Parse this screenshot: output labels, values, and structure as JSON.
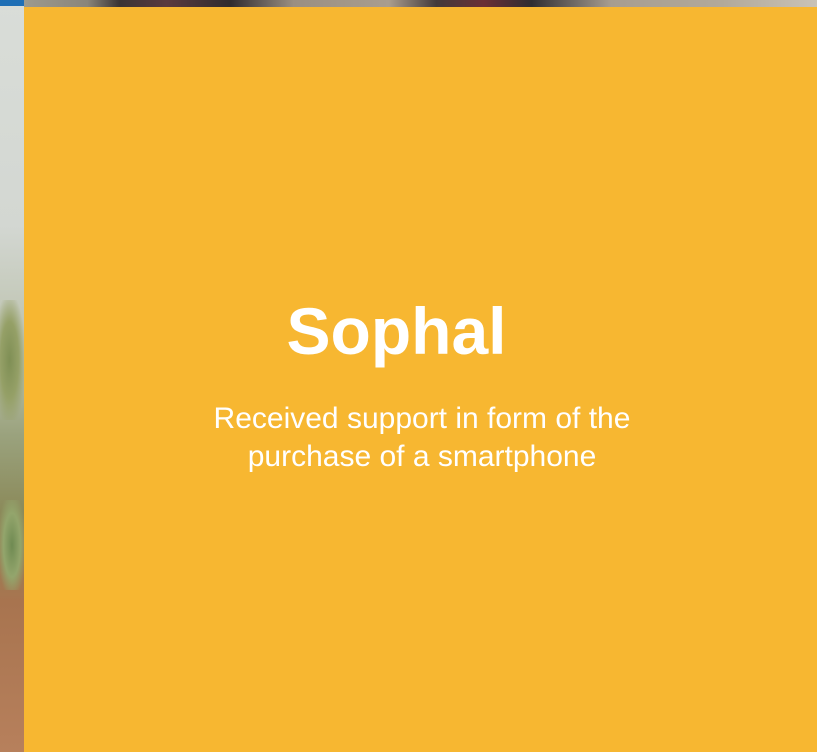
{
  "profile": {
    "name": "Sophal",
    "description": "Received support in form of the purchase of a smartphone"
  },
  "colors": {
    "card_background": "#f7b731",
    "text": "#ffffff",
    "accent": "#1f6fb5"
  }
}
